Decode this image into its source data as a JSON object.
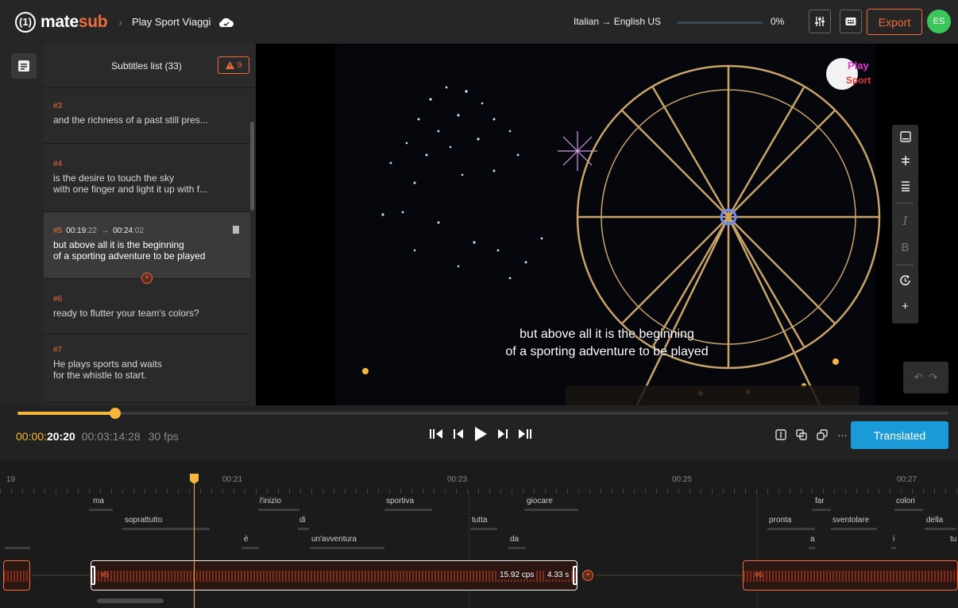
{
  "app": {
    "logo_mark": "(1)",
    "logo_main": "mate",
    "logo_accent": "sub"
  },
  "project": {
    "breadcrumb_sep": "›",
    "name": "Play Sport Viaggi"
  },
  "header": {
    "language_pair": "Italian → English US",
    "progress_percent": 0,
    "progress_label": "0%",
    "export_label": "Export",
    "avatar_initials": "ES"
  },
  "subtitles_panel": {
    "title": "Subtitles list (33)",
    "warning_count": "9",
    "items": [
      {
        "num": "#3",
        "text": "and the richness of a past still pres..."
      },
      {
        "num": "#4",
        "text": "is the desire to touch the sky\nwith one finger and light it up with f..."
      },
      {
        "num": "#5",
        "start_hms": "00:19",
        "start_frames": ":22",
        "arrow": "→",
        "end_hms": "00:24",
        "end_frames": ":02",
        "text": "but above all it is the beginning\nof a sporting adventure to be played"
      },
      {
        "num": "#6",
        "text": "ready to flutter your team's colors?"
      },
      {
        "num": "#7",
        "text": "He plays sports and waits\nfor the whistle to start."
      }
    ]
  },
  "video": {
    "caption": "but above all it is the beginning\nof a sporting adventure to be played",
    "watermark_top": "Play",
    "watermark_bottom": "Sport",
    "tool_italic": "I",
    "tool_bold": "B",
    "tool_add": "+"
  },
  "player": {
    "position_fraction": 0.105,
    "current_time_prefix": "00:00:",
    "current_time_bold": "20:20",
    "total_time": "00:03:14:28",
    "fps": "30 fps",
    "more_label": "···",
    "translated_label": "Translated"
  },
  "timeline": {
    "ruler": [
      "19",
      "00:21",
      "00:23",
      "00:25",
      "00:27"
    ],
    "words_row1": [
      "ma",
      "l'inizio",
      "sportiva",
      "giocare",
      "far",
      "colori"
    ],
    "words_row2": [
      "soprattutto",
      "di",
      "tutta",
      "pronta",
      "sventolare",
      "della"
    ],
    "words_row3": [
      "è",
      "un'avventura",
      "da",
      "a",
      "i",
      "tu"
    ],
    "block5_label": "#5",
    "block5_cps": "15.92 cps",
    "block5_duration": "4.33 s",
    "block6_label": "#6",
    "add_label": "+"
  },
  "colors": {
    "accent": "#f26b3a",
    "playhead": "#f5b73b",
    "primary": "#1a9ad6",
    "avatar": "#3cc55a"
  }
}
